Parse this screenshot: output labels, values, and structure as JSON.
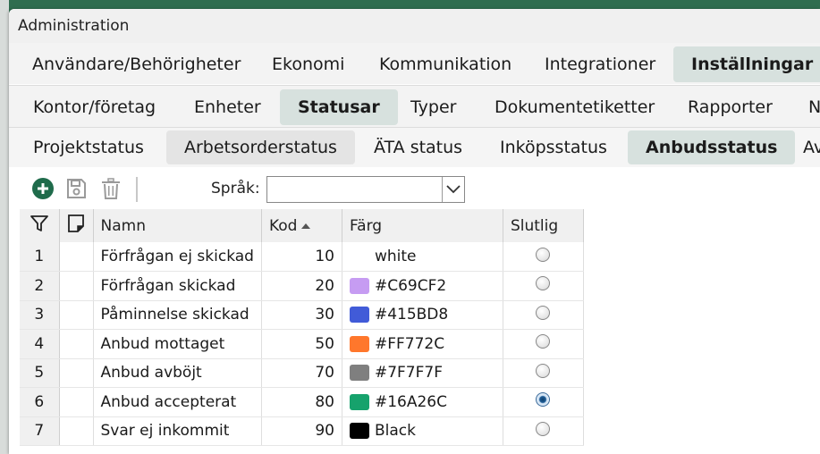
{
  "window": {
    "title": "Administration"
  },
  "tabs_level1": [
    {
      "label": "Användare/Behörigheter",
      "active": false
    },
    {
      "label": "Ekonomi",
      "active": false
    },
    {
      "label": "Kommunikation",
      "active": false
    },
    {
      "label": "Integrationer",
      "active": false
    },
    {
      "label": "Inställningar",
      "active": true
    }
  ],
  "tabs_level2": [
    {
      "label": "Kontor/företag",
      "active": false
    },
    {
      "label": "Enheter",
      "active": false
    },
    {
      "label": "Statusar",
      "active": true
    },
    {
      "label": "Typer",
      "active": false
    },
    {
      "label": "Dokumentetiketter",
      "active": false
    },
    {
      "label": "Rapporter",
      "active": false
    },
    {
      "label": "N",
      "active": false
    }
  ],
  "tabs_level3": [
    {
      "label": "Projektstatus",
      "active": false
    },
    {
      "label": "Arbetsorderstatus",
      "active": false
    },
    {
      "label": "ÄTA status",
      "active": false
    },
    {
      "label": "Inköpsstatus",
      "active": false
    },
    {
      "label": "Anbudsstatus",
      "active": true
    },
    {
      "label": "Av",
      "active": false
    }
  ],
  "toolbar": {
    "language_label": "Språk:",
    "language_value": "",
    "icons": [
      "add-icon",
      "save-icon",
      "delete-icon",
      "chevron-down-icon"
    ]
  },
  "grid": {
    "columns": [
      "",
      "",
      "Namn",
      "Kod",
      "Färg",
      "Slutlig"
    ],
    "sort_column": "Kod",
    "rows": [
      {
        "index": "1",
        "name": "Förfrågan ej skickad",
        "code": "10",
        "color_label": "white",
        "swatch": null,
        "final": false
      },
      {
        "index": "2",
        "name": "Förfrågan skickad",
        "code": "20",
        "color_label": "#C69CF2",
        "swatch": "#C69CF2",
        "final": false
      },
      {
        "index": "3",
        "name": "Påminnelse skickad",
        "code": "30",
        "color_label": "#415BD8",
        "swatch": "#415BD8",
        "final": false
      },
      {
        "index": "4",
        "name": "Anbud mottaget",
        "code": "50",
        "color_label": "#FF772C",
        "swatch": "#FF772C",
        "final": false
      },
      {
        "index": "5",
        "name": "Anbud avböjt",
        "code": "70",
        "color_label": "#7F7F7F",
        "swatch": "#7F7F7F",
        "final": false
      },
      {
        "index": "6",
        "name": "Anbud accepterat",
        "code": "80",
        "color_label": "#16A26C",
        "swatch": "#16A26C",
        "final": true
      },
      {
        "index": "7",
        "name": "Svar ej inkommit",
        "code": "90",
        "color_label": "Black",
        "swatch": "#000000",
        "final": false
      }
    ]
  },
  "colors": {
    "accent": "#1f6b4b",
    "active_tab": "#d7e1de"
  }
}
